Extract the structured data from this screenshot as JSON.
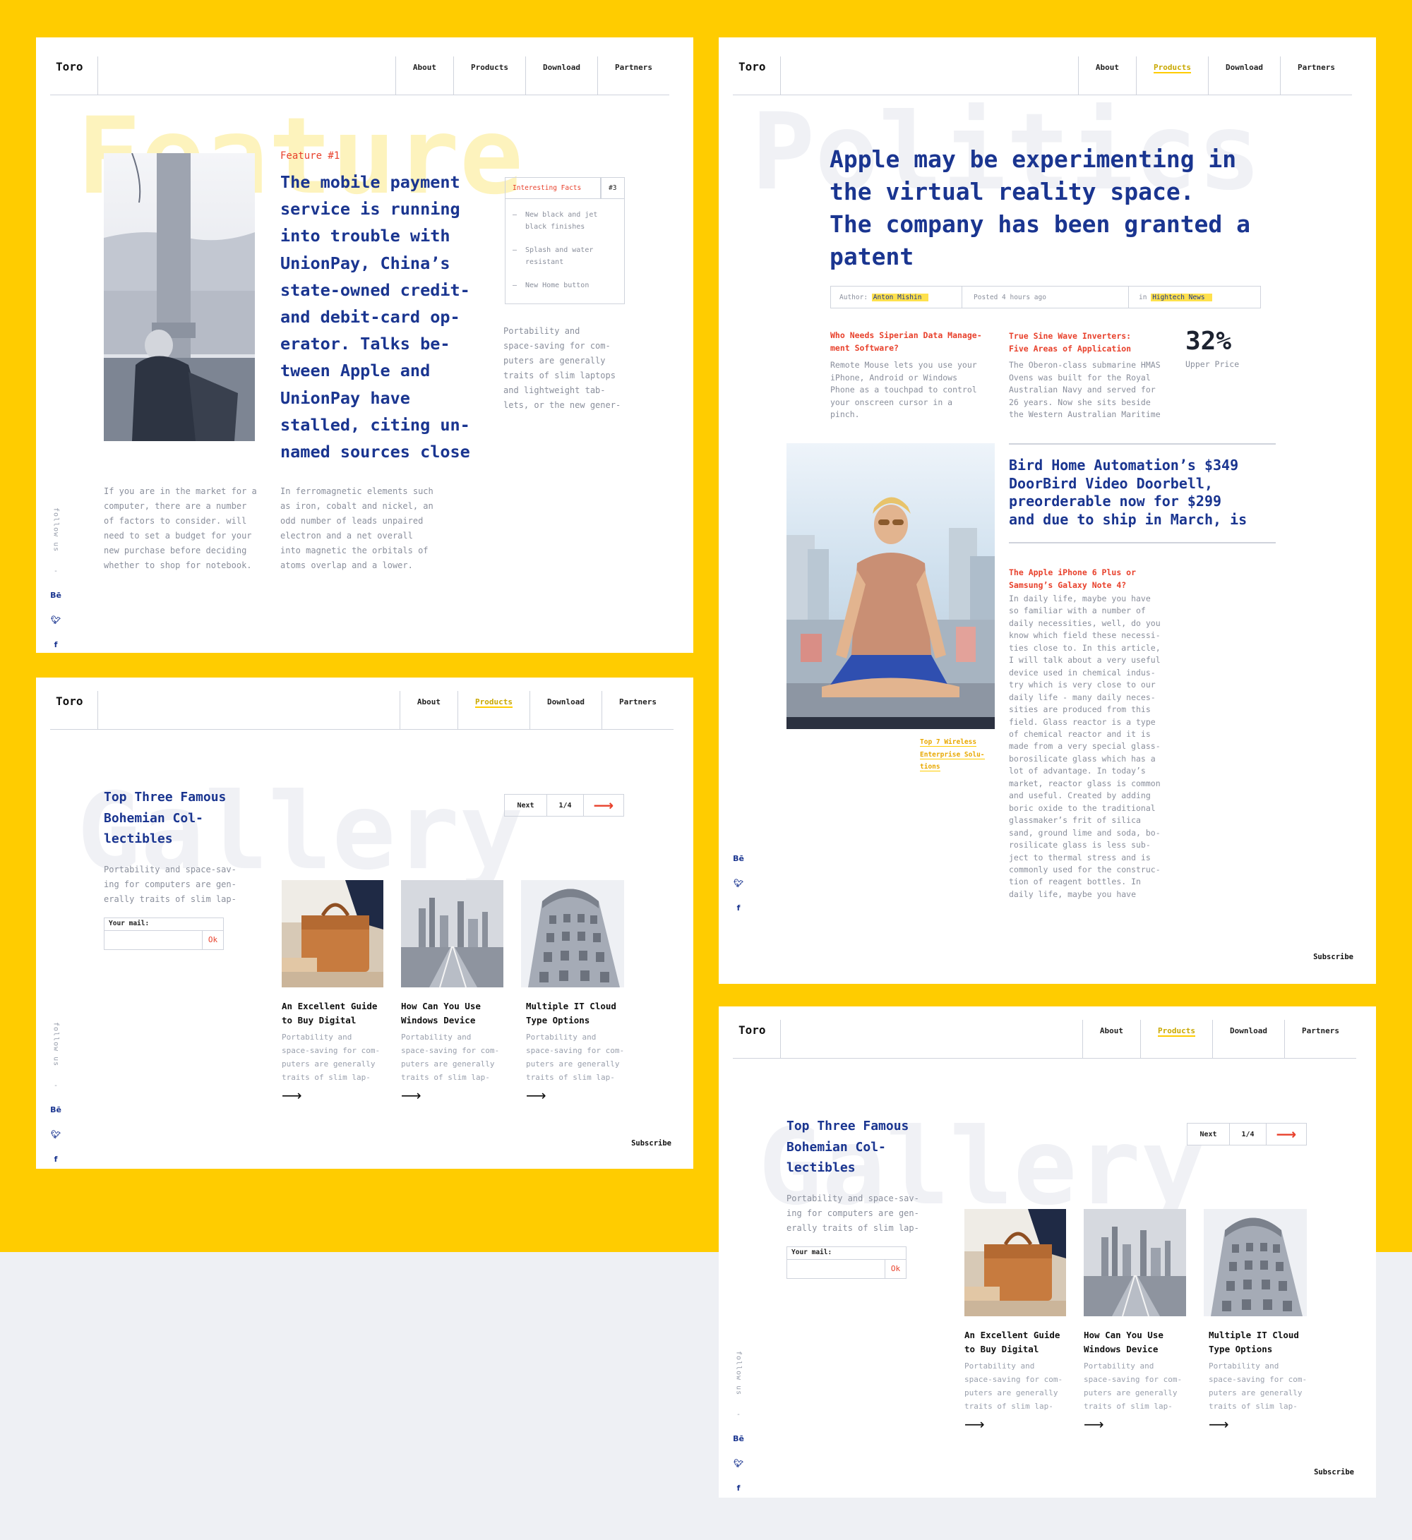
{
  "nav": {
    "logo": "Toro",
    "items": [
      "About",
      "Products",
      "Download",
      "Partners"
    ]
  },
  "follow": {
    "label": "follow us",
    "dash": "-",
    "behance": "Bē",
    "twitter": "🐦",
    "facebook": "f"
  },
  "panel1": {
    "watermark": "Feature",
    "feature_label": "Feature #1",
    "headline": [
      "The mobile payment",
      "service is running",
      "into trouble with",
      "UnionPay, China’s",
      "state-owned credit-",
      "and debit-card op-",
      "erator. Talks be-",
      "tween Apple and",
      "UnionPay have",
      "stalled, citing un-",
      "named sources close"
    ],
    "facts_title": "Interesting Facts",
    "facts_num": "#3",
    "facts": [
      [
        "New black and jet",
        "black finishes"
      ],
      [
        "Splash and water",
        "resistant"
      ],
      [
        "New Home button"
      ]
    ],
    "side_text": [
      "Portability and",
      "space-saving for com-",
      "puters are generally",
      "traits of slim laptops",
      "and lightweight tab-",
      "lets, or the new gener-"
    ],
    "col1": [
      "If you are in the market for a",
      "computer, there are a number",
      "of factors to consider. will",
      "need to set a budget for your",
      "new purchase before deciding",
      "whether to shop for notebook."
    ],
    "col2": [
      "In ferromagnetic elements such",
      "as iron, cobalt and nickel, an",
      "odd number of leads unpaired",
      "electron and a net overall",
      "into magnetic the orbitals of",
      "atoms overlap and a lower."
    ]
  },
  "panel2": {
    "watermark": "Politics",
    "headline": [
      "Apple may be experimenting in",
      "the virtual reality space.",
      "The company has been granted a",
      "patent"
    ],
    "meta": {
      "author_label": "Author:",
      "author": "Anton Mishin",
      "posted": "Posted 4 hours ago",
      "in_label": "in",
      "category": "Hightech News"
    },
    "a1_title": [
      "Who Needs Siperian Data Manage-",
      "ment Software?"
    ],
    "a1_text": [
      "Remote Mouse lets you use your",
      "iPhone, Android or Windows",
      "Phone as a touchpad to control",
      "your onscreen cursor in a",
      "pinch."
    ],
    "a2_title": [
      "True Sine Wave Inverters:",
      "Five Areas of Application"
    ],
    "a2_text": [
      "The Oberon-class submarine HMAS",
      "Ovens was built for the Royal",
      "Australian Navy and served for",
      "26 years. Now she sits beside",
      "the Western Australian Maritime"
    ],
    "stat_value": "32%",
    "stat_label": "Upper Price",
    "big_title": [
      "Bird Home Automation’s $349",
      "DoorBird Video Doorbell,",
      "preorderable now for $299",
      "and due to ship in March, is"
    ],
    "caption": [
      "Top 7 Wireless",
      "Enterprise Solu-",
      "tions"
    ],
    "a3_title": [
      "The Apple iPhone 6 Plus or",
      "Samsung’s Galaxy Note 4?"
    ],
    "a3_text": [
      "In daily life, maybe you have",
      "so familiar with a number of",
      "daily necessities, well, do you",
      "know which field these necessi-",
      "ties close to. In this article,",
      "I will talk about a very useful",
      "device used in chemical indus-",
      "try which is very close to our",
      "daily life - many daily neces-",
      "sities are produced from this",
      "field. Glass reactor is a type",
      "of chemical reactor and it is",
      "made from a very special glass-",
      "borosilicate glass which has a",
      "lot of advantage. In today’s",
      "market, reactor glass is common",
      "and useful. Created by adding",
      "boric oxide to the traditional",
      "glassmaker’s frit of silica",
      "sand, ground lime and soda, bo-",
      "rosilicate glass is less sub-",
      "ject to thermal stress and is",
      "commonly used for the construc-",
      "tion of reagent bottles. In",
      "daily life, maybe you have"
    ],
    "subscribe": "Subscribe"
  },
  "gallery": {
    "watermark": "Gallery",
    "title": [
      "Top Three Famous",
      "Bohemian Col-",
      "lectibles"
    ],
    "text": [
      "Portability and space-sav-",
      "ing for computers are gen-",
      "erally traits of slim lap-"
    ],
    "mail_label": "Your mail:",
    "ok": "Ok",
    "pager": {
      "next": "Next",
      "page": "1/4"
    },
    "cards": [
      {
        "title": [
          "An Excellent Guide",
          "to Buy Digital"
        ],
        "text": [
          "Portability and",
          "space-saving for com-",
          "puters are generally",
          "traits of slim lap-"
        ]
      },
      {
        "title": [
          "How Can You Use",
          "Windows Device"
        ],
        "text": [
          "Portability and",
          "space-saving for com-",
          "puters are generally",
          "traits of slim lap-"
        ]
      },
      {
        "title": [
          "Multiple IT Cloud",
          "Type Options"
        ],
        "text": [
          "Portability and",
          "space-saving for com-",
          "puters are generally",
          "traits of slim lap-"
        ]
      }
    ],
    "subscribe": "Subscribe"
  },
  "colors": {
    "yellow": "#ffcc00",
    "navy": "#1a3590",
    "red": "#e8412c",
    "background": "#eef0f4"
  }
}
